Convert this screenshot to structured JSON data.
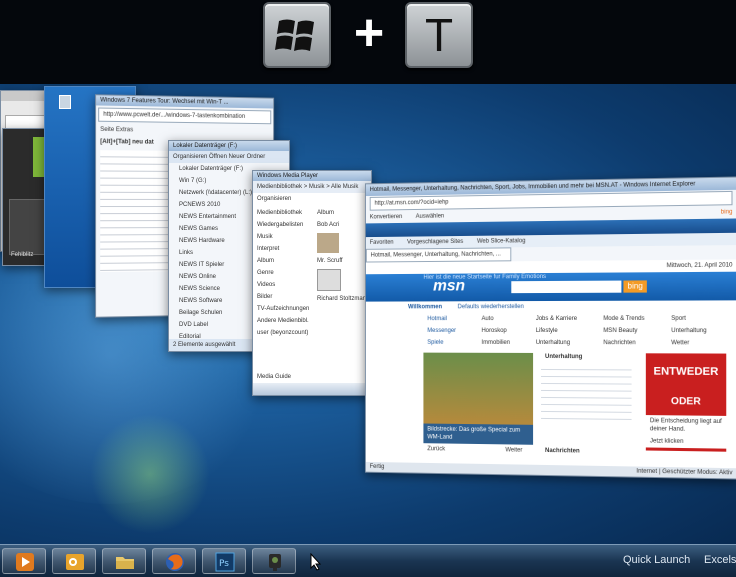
{
  "banner": {
    "key_win_icon": "windows-logo-icon",
    "plus_symbol": "+",
    "key_t_label": "T"
  },
  "windows": {
    "ie_window": {
      "title": "Windows 7 Features Tour: Wechsel mit Win-T ...",
      "address": "http://www.pcwelt.de/.../windows-7-tastenkombination",
      "menu": "Seite  Extras",
      "content_heading": "[Alt]+[Tab] neu dat"
    },
    "explorer_window": {
      "title": "Lokaler Datenträger (F:)",
      "path": "Lokaler Datenträger",
      "folders": [
        "Lokaler Datenträger (F:)",
        "Win 7 (G:)",
        "Netzwerk (\\\\datacenter) (L:)",
        "PCNEWS 2010",
        "NEWS Entertainment",
        "NEWS Games",
        "NEWS Hardware",
        "Links",
        "NEWS IT Spieler",
        "NEWS Online",
        "NEWS Science",
        "NEWS Software",
        "Beilage Schulen",
        "DVD Label",
        "Editorial",
        "Entertainment",
        "Hardware",
        "Impressum",
        "Inhalt",
        "Konsum"
      ],
      "status": "2 Elemente ausgewählt",
      "toolbar": "Organisieren  Öffnen  Neuer Ordner"
    },
    "wmp_window": {
      "title": "Windows Media Player",
      "path": "Medienbibliothek > Musik > Alle Musik",
      "organize": "Organisieren",
      "sidebar": [
        "Medienbibliothek",
        "Wiedergabelisten",
        "Musik",
        "Interpret",
        "Album",
        "Genre",
        "Videos",
        "Bilder",
        "TV-Aufzeichnungen",
        "Andere Medienbibl.",
        "user (beyonzcount)"
      ],
      "album_header": "Album",
      "bob_acri": "Bob Acri",
      "artist_2": "Mr. Scruff",
      "artist_3": "Richard Stoltzman",
      "media_guide": "Media Guide"
    },
    "msn_window": {
      "title": "Hotmail, Messenger, Unterhaltung, Nachrichten, Sport, Jobs, Immobilien und mehr bei MSN.AT - Windows Internet Explorer",
      "address": "http://at.msn.com/?ocid=iehp",
      "menu": [
        "Konvertieren",
        "Auswählen"
      ],
      "bing_label": "bing",
      "favorites": "Favoriten",
      "favorites_links": [
        "Vorgeschlagene Sites",
        "Web Slice-Katalog"
      ],
      "tab_title": "Hotmail, Messenger, Unterhaltung, Nachrichten, ...",
      "date": "Mittwoch, 21. April 2010",
      "nav_links": [
        "Web",
        "MSN",
        "News",
        "Bilder",
        "Video"
      ],
      "page_tagline": "Hier ist die neue Startseite fur Family Emotions",
      "logo": "msn",
      "bing_button": "bing",
      "welcome": "Willkommen",
      "welcome_link": "Defaults wiederherstellen",
      "left_links": [
        "Hotmail",
        "Messenger",
        "Spiele"
      ],
      "col2_links": [
        "Auto",
        "Horoskop",
        "Immobilien"
      ],
      "col3_links": [
        "Jobs & Karriere",
        "Lifestyle",
        "Unterhaltung"
      ],
      "col4_links": [
        "Mode & Trends",
        "MSN Beauty",
        "Nachrichten"
      ],
      "col5_links": [
        "Sport",
        "Unterhaltung",
        "Wetter"
      ],
      "caption": "Bildstrecke: Das große Special zum WM-Land",
      "zuruck": "Zurück",
      "weiter": "Weiter",
      "unterhaltung_title": "Unterhaltung",
      "sport_label": "Sport",
      "nachrichten_label": "Nachrichten",
      "ad_line1": "ENTWEDER",
      "ad_line2": "ODER",
      "ad_caption": "Die Entscheidung liegt auf deiner Hand.",
      "ad_button": "Jetzt klicken",
      "status_left": "Fertig",
      "status_right": "Internet | Geschützter Modus: Aktiv"
    },
    "green_app_window": {
      "label": "Fehlblitz"
    }
  },
  "taskbar": {
    "items": [
      "media-player-icon",
      "outlook-icon",
      "explorer-folder-icon",
      "firefox-icon",
      "photoshop-icon",
      "camera-app-icon"
    ],
    "quick_launch": "Quick Launch",
    "excel_label": "Excelshe"
  }
}
